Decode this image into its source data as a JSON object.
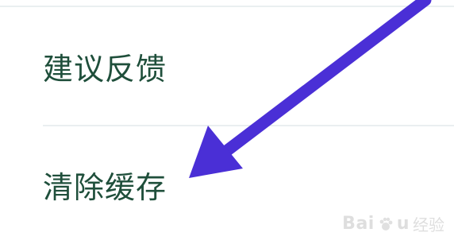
{
  "settings_list": {
    "items": [
      {
        "label": "建议反馈"
      },
      {
        "label": "清除缓存"
      }
    ]
  },
  "annotation": {
    "arrow_color": "#4a2fd6"
  },
  "watermark": {
    "logo_text": "Bai",
    "paw_icon": "paw-icon",
    "logo_text_2": "u",
    "sub_text": "经验"
  },
  "colors": {
    "background": "#ffffff",
    "divider": "#eaeff0",
    "label": "#1f4f3b"
  }
}
